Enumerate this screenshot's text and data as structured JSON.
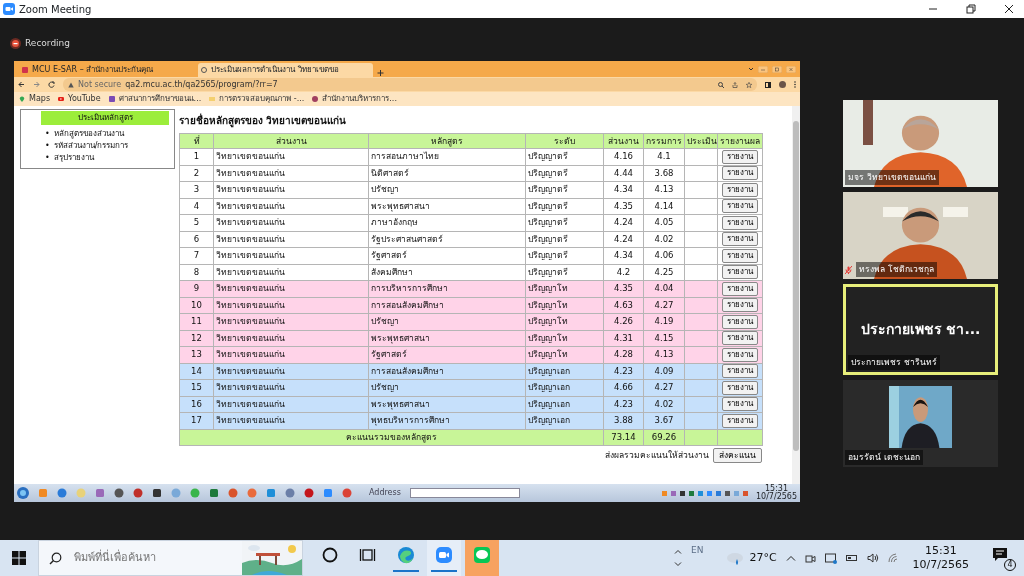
{
  "window": {
    "title": "Zoom Meeting"
  },
  "recording": {
    "label": "Recording"
  },
  "browser": {
    "tabs": [
      {
        "label": "MCU E-SAR – สำนักงานประกันคุณ",
        "selected": false
      },
      {
        "label": "ประเมินผลการดำเนินงาน วิทยาเขตขอ",
        "selected": true
      }
    ],
    "address": {
      "security": "Not secure",
      "url": "qa2.mcu.ac.th/qa2565/program/?rr=7"
    },
    "bookmarks": [
      "Maps",
      "YouTube",
      "ศาสนาการศึกษาขอนแ...",
      "การตรวจสอบคุณภาพ -...",
      "สำนักงานบริหารการ..."
    ]
  },
  "page": {
    "menu": {
      "title": "ประเมินหลักสูตร",
      "bullet": "•",
      "items": [
        "หลักสูตรของส่วนงาน",
        "รหัสส่วนงาน/กรรมการ",
        "สรุปรายงาน"
      ]
    },
    "heading": "รายชื่อหลักสูตรของ วิทยาเขตขอนแก่น",
    "table": {
      "columns": [
        "ที่",
        "ส่วนงาน",
        "หลักสูตร",
        "ระดับ",
        "ส่วนงาน",
        "กรรมการ",
        "ประเมิน",
        "รายงานผล"
      ],
      "rows": [
        {
          "no": "1",
          "unit": "วิทยาเขตขอนแก่น",
          "program": "การสอนภาษาไทย",
          "level": "ปริญญาตรี",
          "unit_score": "4.16",
          "committee_score": "4.1",
          "action": "รายงาน",
          "color": "#ffffff"
        },
        {
          "no": "2",
          "unit": "วิทยาเขตขอนแก่น",
          "program": "นิติศาสตร์",
          "level": "ปริญญาตรี",
          "unit_score": "4.44",
          "committee_score": "3.68",
          "action": "รายงาน",
          "color": "#ffffff"
        },
        {
          "no": "3",
          "unit": "วิทยาเขตขอนแก่น",
          "program": "ปรัชญา",
          "level": "ปริญญาตรี",
          "unit_score": "4.34",
          "committee_score": "4.13",
          "action": "รายงาน",
          "color": "#ffffff"
        },
        {
          "no": "4",
          "unit": "วิทยาเขตขอนแก่น",
          "program": "พระพุทธศาสนา",
          "level": "ปริญญาตรี",
          "unit_score": "4.35",
          "committee_score": "4.14",
          "action": "รายงาน",
          "color": "#ffffff"
        },
        {
          "no": "5",
          "unit": "วิทยาเขตขอนแก่น",
          "program": "ภาษาอังกฤษ",
          "level": "ปริญญาตรี",
          "unit_score": "4.24",
          "committee_score": "4.05",
          "action": "รายงาน",
          "color": "#ffffff"
        },
        {
          "no": "6",
          "unit": "วิทยาเขตขอนแก่น",
          "program": "รัฐประศาสนศาสตร์",
          "level": "ปริญญาตรี",
          "unit_score": "4.24",
          "committee_score": "4.02",
          "action": "รายงาน",
          "color": "#ffffff"
        },
        {
          "no": "7",
          "unit": "วิทยาเขตขอนแก่น",
          "program": "รัฐศาสตร์",
          "level": "ปริญญาตรี",
          "unit_score": "4.34",
          "committee_score": "4.06",
          "action": "รายงาน",
          "color": "#ffffff"
        },
        {
          "no": "8",
          "unit": "วิทยาเขตขอนแก่น",
          "program": "สังคมศึกษา",
          "level": "ปริญญาตรี",
          "unit_score": "4.2",
          "committee_score": "4.25",
          "action": "รายงาน",
          "color": "#ffffff"
        },
        {
          "no": "9",
          "unit": "วิทยาเขตขอนแก่น",
          "program": "การบริหารการศึกษา",
          "level": "ปริญญาโท",
          "unit_score": "4.35",
          "committee_score": "4.04",
          "action": "รายงาน",
          "color": "#ffd3e8"
        },
        {
          "no": "10",
          "unit": "วิทยาเขตขอนแก่น",
          "program": "การสอนสังคมศึกษา",
          "level": "ปริญญาโท",
          "unit_score": "4.63",
          "committee_score": "4.27",
          "action": "รายงาน",
          "color": "#ffd3e8"
        },
        {
          "no": "11",
          "unit": "วิทยาเขตขอนแก่น",
          "program": "ปรัชญา",
          "level": "ปริญญาโท",
          "unit_score": "4.26",
          "committee_score": "4.19",
          "action": "รายงาน",
          "color": "#ffd3e8"
        },
        {
          "no": "12",
          "unit": "วิทยาเขตขอนแก่น",
          "program": "พระพุทธศาสนา",
          "level": "ปริญญาโท",
          "unit_score": "4.31",
          "committee_score": "4.15",
          "action": "รายงาน",
          "color": "#ffd3e8"
        },
        {
          "no": "13",
          "unit": "วิทยาเขตขอนแก่น",
          "program": "รัฐศาสตร์",
          "level": "ปริญญาโท",
          "unit_score": "4.28",
          "committee_score": "4.13",
          "action": "รายงาน",
          "color": "#ffd3e8"
        },
        {
          "no": "14",
          "unit": "วิทยาเขตขอนแก่น",
          "program": "การสอนสังคมศึกษา",
          "level": "ปริญญาเอก",
          "unit_score": "4.23",
          "committee_score": "4.09",
          "action": "รายงาน",
          "color": "#c6e0fb"
        },
        {
          "no": "15",
          "unit": "วิทยาเขตขอนแก่น",
          "program": "ปรัชญา",
          "level": "ปริญญาเอก",
          "unit_score": "4.66",
          "committee_score": "4.27",
          "action": "รายงาน",
          "color": "#c6e0fb"
        },
        {
          "no": "16",
          "unit": "วิทยาเขตขอนแก่น",
          "program": "พระพุทธศาสนา",
          "level": "ปริญญาเอก",
          "unit_score": "4.23",
          "committee_score": "4.02",
          "action": "รายงาน",
          "color": "#c6e0fb"
        },
        {
          "no": "17",
          "unit": "วิทยาเขตขอนแก่น",
          "program": "พุทธบริหารการศึกษา",
          "level": "ปริญญาเอก",
          "unit_score": "3.88",
          "committee_score": "3.67",
          "action": "รายงาน",
          "color": "#c6e0fb"
        }
      ],
      "total": {
        "label": "คะแนนรวมของหลักสูตร",
        "unit_score": "73.14",
        "committee_score": "69.26"
      }
    },
    "send": {
      "label": "ส่งผลรวมคะแนนให้ส่วนงาน",
      "button": "ส่งคะแนน"
    }
  },
  "inner_taskbar": {
    "address_label": "Address",
    "time": "15:31",
    "date": "10/7/2565"
  },
  "participants": [
    {
      "kind": "video",
      "name": "มจร วิทยาเขตขอนแก่น",
      "muted": false,
      "speaking": false
    },
    {
      "kind": "video",
      "name": "ทรงพล โชติกเวชกุล",
      "muted": true,
      "speaking": false
    },
    {
      "kind": "avatar",
      "display": "ประกายเพชร ชา...",
      "name": "ประกายเพชร ชารินทร์",
      "muted": false,
      "speaking": true
    },
    {
      "kind": "video-small",
      "name": "อมรรัตน์ เดชะนอก",
      "muted": false,
      "speaking": false
    }
  ],
  "taskbar": {
    "search_placeholder": "พิมพ์ที่นี่เพื่อค้นหา",
    "apps": [
      {
        "kind": "cortana",
        "running": false,
        "flashing": false
      },
      {
        "kind": "task-view",
        "running": false,
        "flashing": false
      },
      {
        "kind": "edge",
        "running": true,
        "flashing": false
      },
      {
        "kind": "zoom",
        "running": true,
        "flashing": false
      },
      {
        "kind": "line",
        "running": false,
        "flashing": true
      }
    ],
    "language": "EN",
    "temperature": "27°C",
    "time": "15:31",
    "date": "10/7/2565",
    "notifications": "4"
  }
}
